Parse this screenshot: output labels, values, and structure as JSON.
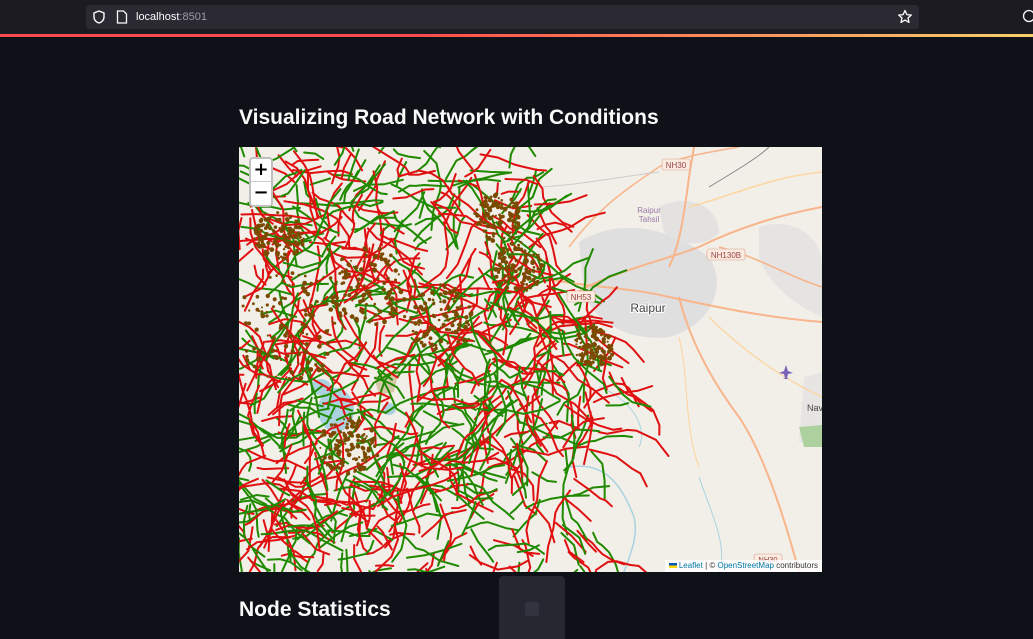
{
  "browser": {
    "url_host": "localhost",
    "url_port": ":8501"
  },
  "page": {
    "title_map": "Visualizing Road Network with Conditions",
    "title_stats": "Node Statistics"
  },
  "map": {
    "zoom_in": "+",
    "zoom_out": "−",
    "attribution": {
      "leaflet": "Leaflet",
      "sep": " | © ",
      "osm": "OpenStreetMap",
      "suffix": " contributors"
    },
    "labels": {
      "nh30": "NH30",
      "nh130b": "NH130B",
      "nh53": "NH53",
      "raipur": "Raipur",
      "raipur_tahsil_1": "Raipur",
      "raipur_tahsil_2": "Tahsil",
      "nava": "Nav",
      "nh30_bottom": "NH30"
    },
    "colors": {
      "road_good": "#1f8a00",
      "road_bad": "#e01010",
      "node": "#7a4a00",
      "base": "#f2efe9"
    }
  }
}
